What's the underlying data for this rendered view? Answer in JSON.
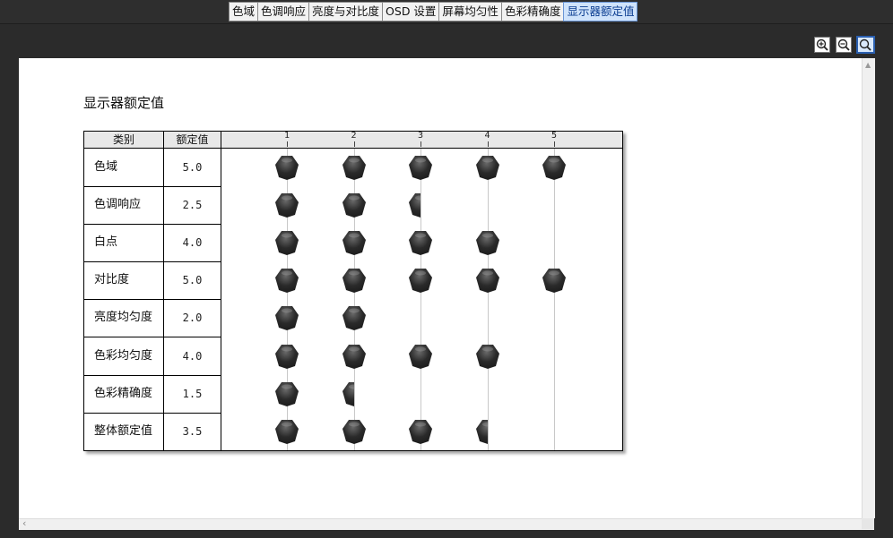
{
  "tabs": [
    {
      "label": "色域",
      "active": false
    },
    {
      "label": "色调响应",
      "active": false
    },
    {
      "label": "亮度与对比度",
      "active": false
    },
    {
      "label": "OSD 设置",
      "active": false
    },
    {
      "label": "屏幕均匀性",
      "active": false
    },
    {
      "label": "色彩精确度",
      "active": false
    },
    {
      "label": "显示器额定值",
      "active": true
    }
  ],
  "toolbar": {
    "icons": [
      "zoom-in-icon",
      "zoom-out-icon",
      "zoom-fit-icon"
    ]
  },
  "report": {
    "title": "显示器额定值",
    "columns": {
      "category": "类别",
      "rating": "额定值"
    },
    "scale": [
      "1",
      "2",
      "3",
      "4",
      "5"
    ],
    "scale_max": 5,
    "rows": [
      {
        "label": "色域",
        "value": "5.0",
        "rating": 5.0
      },
      {
        "label": "色调响应",
        "value": "2.5",
        "rating": 2.5
      },
      {
        "label": "白点",
        "value": "4.0",
        "rating": 4.0
      },
      {
        "label": "对比度",
        "value": "5.0",
        "rating": 5.0
      },
      {
        "label": "亮度均匀度",
        "value": "2.0",
        "rating": 2.0
      },
      {
        "label": "色彩均匀度",
        "value": "4.0",
        "rating": 4.0
      },
      {
        "label": "色彩精确度",
        "value": "1.5",
        "rating": 1.5
      },
      {
        "label": "整体额定值",
        "value": "3.5",
        "rating": 3.5
      }
    ]
  },
  "colors": {
    "knob_dark": "#1a1a1a",
    "knob_light": "#6a6a6a",
    "active_tab": "#cfe3fb"
  }
}
